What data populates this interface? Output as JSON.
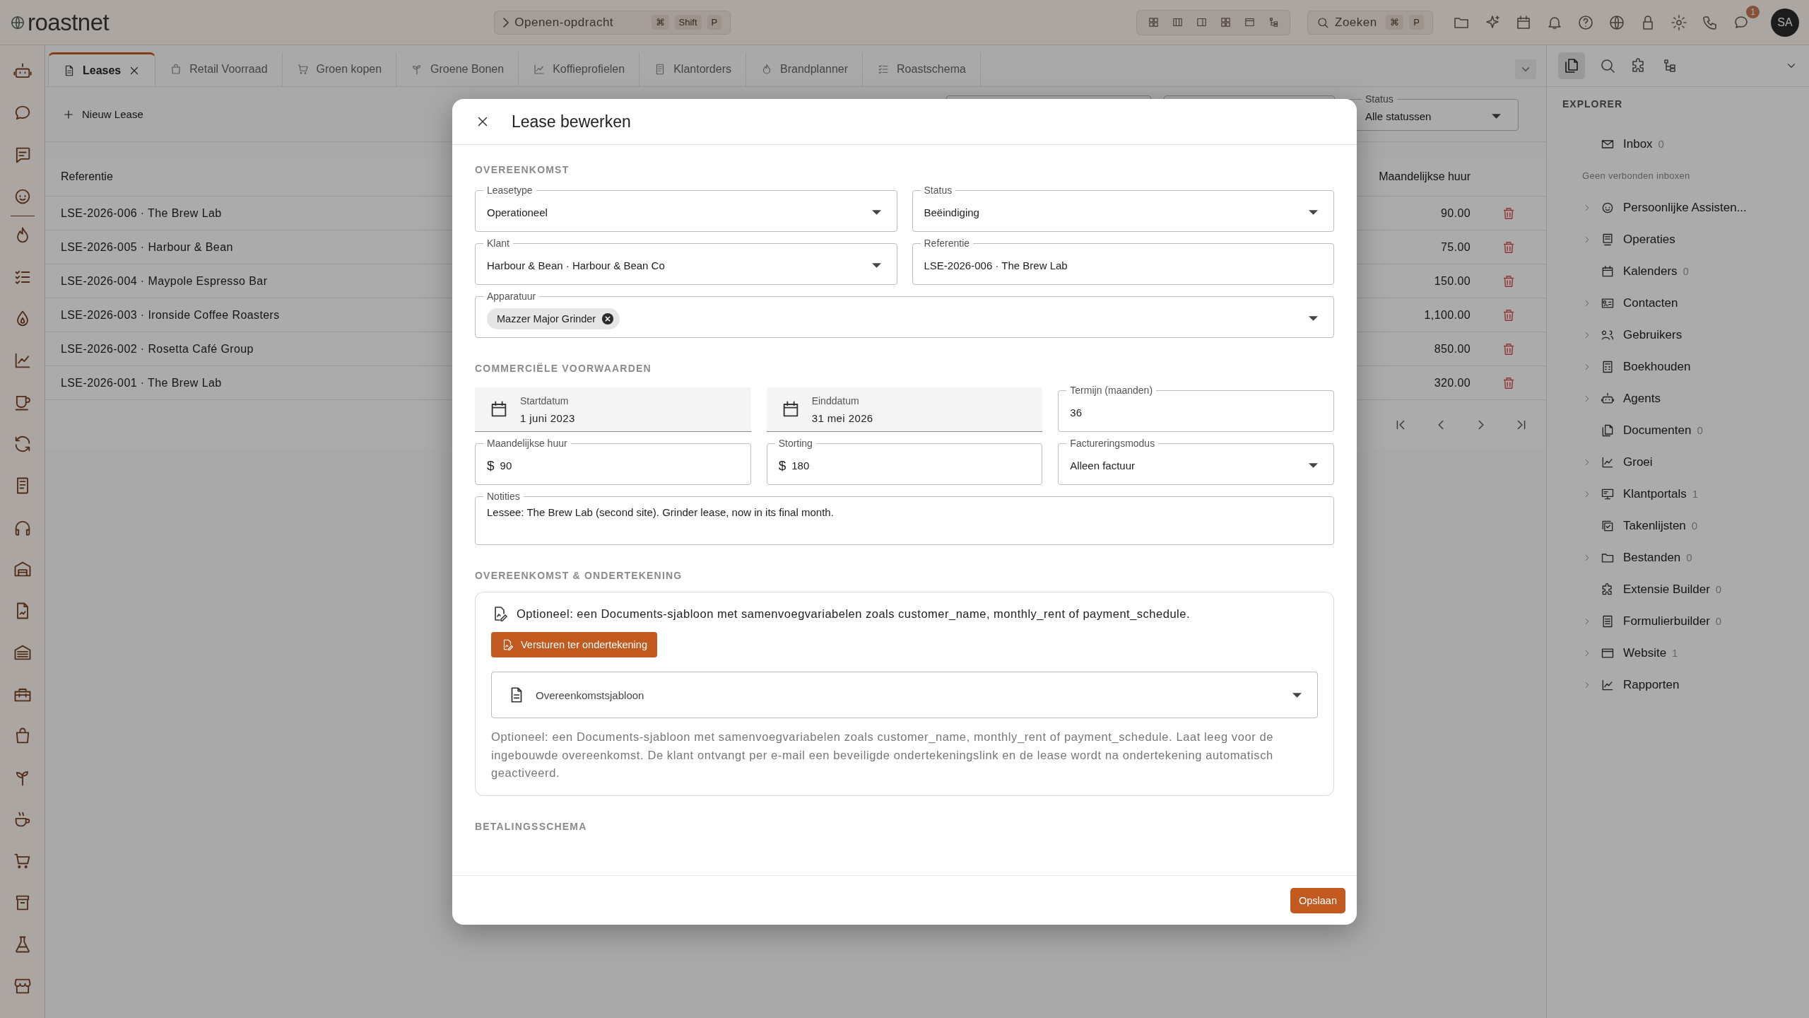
{
  "app": {
    "logo": "roastnet"
  },
  "command_palette": {
    "label": "Openen-opdracht",
    "keys": [
      "⌘",
      "Shift",
      "P"
    ]
  },
  "search": {
    "label": "Zoeken",
    "keys": [
      "⌘",
      "P"
    ]
  },
  "notifications": {
    "badge": "1"
  },
  "user": {
    "initials": "SA"
  },
  "tabs": [
    {
      "label": "Leases",
      "selected": true,
      "closable": true
    },
    {
      "label": "Retail Voorraad",
      "selected": false,
      "closable": false
    },
    {
      "label": "Groen kopen",
      "selected": false,
      "closable": false
    },
    {
      "label": "Groene Bonen",
      "selected": false,
      "closable": false
    },
    {
      "label": "Koffieprofielen",
      "selected": false,
      "closable": false
    },
    {
      "label": "Klantorders",
      "selected": false,
      "closable": false
    },
    {
      "label": "Brandplanner",
      "selected": false,
      "closable": false
    },
    {
      "label": "Roastschema",
      "selected": false,
      "closable": false
    }
  ],
  "toolbar": {
    "new_button": "Nieuw Lease",
    "filters": [
      {
        "label": "Status",
        "value": "Alle statussen"
      }
    ]
  },
  "table": {
    "columns": [
      "Referentie",
      "Maandelijkse huur"
    ],
    "rows": [
      {
        "reference": "LSE-2026-006 · The Brew Lab",
        "monthly_rent": "90.00"
      },
      {
        "reference": "LSE-2026-005 · Harbour & Bean",
        "monthly_rent": "75.00"
      },
      {
        "reference": "LSE-2026-004 · Maypole Espresso Bar",
        "monthly_rent": "150.00"
      },
      {
        "reference": "LSE-2026-003 · Ironside Coffee Roasters",
        "monthly_rent": "1,100.00"
      },
      {
        "reference": "LSE-2026-002 · Rosetta Café Group",
        "monthly_rent": "850.00"
      },
      {
        "reference": "LSE-2026-001 · The Brew Lab",
        "monthly_rent": "320.00"
      }
    ]
  },
  "explorer": {
    "title": "EXPLORER",
    "items": [
      {
        "kind": "item",
        "label": "Inbox",
        "count": "0",
        "expandable": false
      },
      {
        "kind": "note",
        "label": "Geen verbonden inboxen"
      },
      {
        "kind": "item",
        "label": "Persoonlijke Assisten...",
        "expandable": true
      },
      {
        "kind": "item",
        "label": "Operaties",
        "expandable": true
      },
      {
        "kind": "item",
        "label": "Kalenders",
        "count": "0",
        "expandable": false
      },
      {
        "kind": "item",
        "label": "Contacten",
        "expandable": true
      },
      {
        "kind": "item",
        "label": "Gebruikers",
        "expandable": true
      },
      {
        "kind": "item",
        "label": "Boekhouden",
        "expandable": true
      },
      {
        "kind": "item",
        "label": "Agents",
        "expandable": true
      },
      {
        "kind": "item",
        "label": "Documenten",
        "count": "0",
        "expandable": false
      },
      {
        "kind": "item",
        "label": "Groei",
        "expandable": true
      },
      {
        "kind": "item",
        "label": "Klantportals",
        "count": "1",
        "expandable": true
      },
      {
        "kind": "item",
        "label": "Takenlijsten",
        "count": "0",
        "expandable": false
      },
      {
        "kind": "item",
        "label": "Bestanden",
        "count": "0",
        "expandable": true
      },
      {
        "kind": "item",
        "label": "Extensie Builder",
        "count": "0",
        "expandable": false
      },
      {
        "kind": "item",
        "label": "Formulierbuilder",
        "count": "0",
        "expandable": true
      },
      {
        "kind": "item",
        "label": "Website",
        "count": "1",
        "expandable": true
      },
      {
        "kind": "item",
        "label": "Rapporten",
        "expandable": true
      }
    ]
  },
  "modal": {
    "title": "Lease bewerken",
    "agreement": {
      "heading": "OVEREENKOMST",
      "lease_type": {
        "label": "Leasetype",
        "value": "Operationeel"
      },
      "status": {
        "label": "Status",
        "value": "Beëindiging"
      },
      "customer": {
        "label": "Klant",
        "value": "Harbour & Bean · Harbour & Bean Co"
      },
      "reference": {
        "label": "Referentie",
        "value": "LSE-2026-006 · The Brew Lab"
      },
      "equipment": {
        "label": "Apparatuur",
        "chips": [
          "Mazzer Major Grinder"
        ]
      }
    },
    "terms": {
      "heading": "COMMERCIËLE VOORWAARDEN",
      "start_date": {
        "label": "Startdatum",
        "value": "1 juni 2023"
      },
      "end_date": {
        "label": "Einddatum",
        "value": "31 mei 2026"
      },
      "term": {
        "label": "Termijn (maanden)",
        "value": "36"
      },
      "monthly_rent": {
        "label": "Maandelijkse huur",
        "prefix": "$",
        "value": "90"
      },
      "deposit": {
        "label": "Storting",
        "prefix": "$",
        "value": "180"
      },
      "billing_mode": {
        "label": "Factureringsmodus",
        "value": "Alleen factuur"
      },
      "notes": {
        "label": "Notities",
        "value": "Lessee: The Brew Lab (second site). Grinder lease, now in its final month."
      }
    },
    "signing": {
      "heading": "OVEREENKOMST & ONDERTEKENING",
      "intro": "Optioneel: een Documents-sjabloon met samenvoegvariabelen zoals customer_name, monthly_rent of payment_schedule.",
      "send_button": "Versturen ter ondertekening",
      "template": {
        "placeholder": "Overeenkomstsjabloon"
      },
      "help": "Optioneel: een Documents-sjabloon met samenvoegvariabelen zoals customer_name, monthly_rent of payment_schedule. Laat leeg voor de ingebouwde overeenkomst. De klant ontvangt per e-mail een beveiligde ondertekeningslink en de lease wordt na ondertekening automatisch geactiveerd."
    },
    "payment_schedule": {
      "heading": "BETALINGSSCHEMA"
    },
    "save_button": "Opslaan"
  }
}
